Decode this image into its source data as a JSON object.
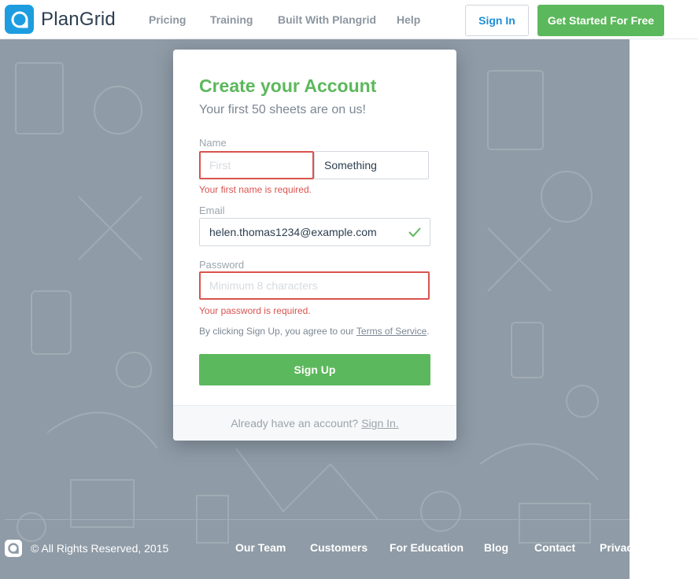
{
  "brand": {
    "name": "PlanGrid"
  },
  "nav": {
    "links": [
      "Pricing",
      "Training",
      "Built With Plangrid",
      "Help"
    ],
    "sign_in": "Sign In",
    "get_started": "Get Started For Free"
  },
  "form": {
    "title": "Create your Account",
    "subtitle": "Your first 50 sheets are on us!",
    "name_label": "Name",
    "first_placeholder": "First",
    "first_value": "",
    "last_value": "Something",
    "first_error": "Your first name is required.",
    "email_label": "Email",
    "email_value": "helen.thomas1234@example.com",
    "email_valid": true,
    "password_label": "Password",
    "password_placeholder": "Minimum 8 characters",
    "password_error": "Your password is required.",
    "terms_prefix": "By clicking Sign Up, you agree to our",
    "terms_link": "Terms of Service",
    "terms_suffix": ".",
    "signup_button": "Sign Up",
    "have_account": "Already have an account?",
    "signin_link": "Sign In."
  },
  "footer": {
    "copyright": "© All Rights Reserved, 2015",
    "links": [
      "Our Team",
      "Customers",
      "For Education",
      "Blog",
      "Contact",
      "Privacy"
    ]
  },
  "colors": {
    "brand_blue": "#1d9de0",
    "accent_green": "#5cb85c",
    "error_red": "#d9534f",
    "background": "#8f9ba6"
  }
}
